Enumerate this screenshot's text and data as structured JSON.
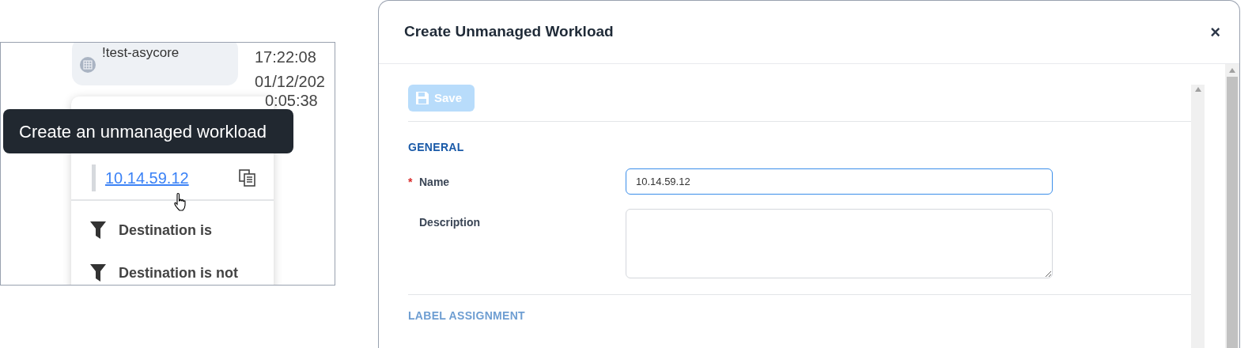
{
  "background_panel": {
    "tag": {
      "label": "!test-asycore"
    },
    "times": [
      "17:22:08",
      "01/12/202",
      "0:05:38"
    ]
  },
  "popover": {
    "address_link": "10.14.59.12",
    "actions": [
      {
        "label": "Destination is"
      },
      {
        "label": "Destination is not"
      }
    ]
  },
  "tooltip": "Create an unmanaged workload",
  "dialog": {
    "title": "Create Unmanaged Workload",
    "close": "×",
    "save_button": {
      "label": "Save",
      "disabled": true
    },
    "sections": [
      {
        "title": "GENERAL",
        "dimmed": false,
        "fields": [
          {
            "label": "Name",
            "required_marker": "*",
            "kind": "input",
            "value": "10.14.59.12",
            "focused": true
          },
          {
            "label": "Description",
            "kind": "textarea",
            "focused": false
          }
        ]
      },
      {
        "title": "LABEL ASSIGNMENT",
        "dimmed": true
      }
    ]
  }
}
